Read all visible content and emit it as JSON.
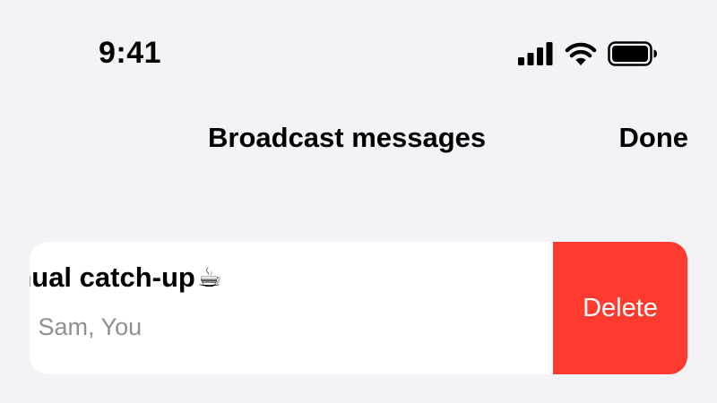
{
  "status_bar": {
    "time": "9:41",
    "icons": [
      "cellular-signal-icon",
      "wifi-icon",
      "battery-icon"
    ]
  },
  "nav": {
    "title": "Broadcast messages",
    "done_label": "Done"
  },
  "list": {
    "rows": [
      {
        "title": "Annual catch-up",
        "title_emoji": "☕",
        "subtitle": "Alex, Sam, You",
        "swipe_action_label": "Delete"
      }
    ]
  },
  "colors": {
    "background": "#f2f2f7",
    "card": "#ffffff",
    "destructive": "#ff3b30",
    "secondary_text": "#8e8e93"
  }
}
